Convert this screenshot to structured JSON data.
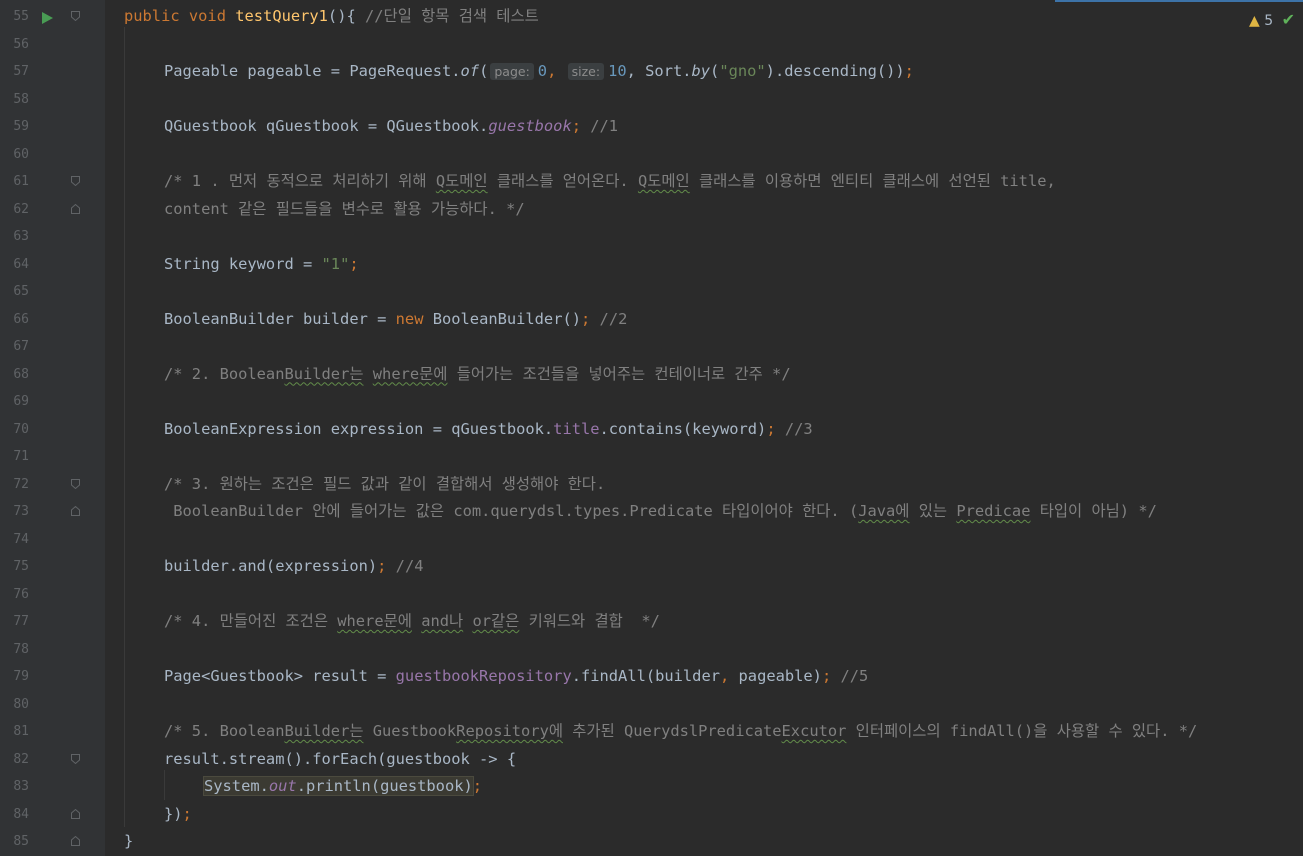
{
  "colors": {
    "background": "#2b2b2b",
    "gutter": "#313335",
    "keyword": "#cc7832",
    "method_decl": "#ffc66d",
    "comment": "#808080",
    "string": "#6a8759",
    "number": "#6897bb",
    "field": "#9876aa",
    "default_text": "#a9b7c6"
  },
  "inspections": {
    "warning_count": "5",
    "warning_icon": "warning-triangle-icon",
    "status_icon": "check-icon"
  },
  "lines": {
    "l55": {
      "num": "55",
      "a": "public",
      "b": " ",
      "c": "void",
      "d": " ",
      "e": "testQuery1",
      "f": "(){ ",
      "g": "//단일 항목 검색 테스트"
    },
    "l56": {
      "num": "56"
    },
    "l57": {
      "num": "57",
      "a": "Pageable pageable = PageRequest.",
      "b": "of",
      "c": "(",
      "hint1": "page:",
      "d": "0",
      "e": ",",
      "hint2": "size:",
      "f": "10",
      "g": ", Sort.",
      "h": "by",
      "i": "(",
      "j": "\"gno\"",
      "k": ").descending())",
      "l": ";"
    },
    "l58": {
      "num": "58"
    },
    "l59": {
      "num": "59",
      "a": "QGuestbook qGuestbook = QGuestbook.",
      "b": "guestbook",
      "c": ";",
      "d": " //1"
    },
    "l60": {
      "num": "60"
    },
    "l61": {
      "num": "61",
      "a": "/* 1 . 먼저 동적으로 처리하기 위해 ",
      "b": "Q도메인",
      "c": " 클래스를 얻어온다. ",
      "d": "Q도메인",
      "e": " 클래스를 이용하면 엔티티 클래스에 선언된 title,"
    },
    "l62": {
      "num": "62",
      "a": "content 같은 필드들을 변수로 활용 가능하다. */"
    },
    "l63": {
      "num": "63"
    },
    "l64": {
      "num": "64",
      "a": "String keyword = ",
      "b": "\"1\"",
      "c": ";"
    },
    "l65": {
      "num": "65"
    },
    "l66": {
      "num": "66",
      "a": "BooleanBuilder builder = ",
      "b": "new",
      "c": " BooleanBuilder()",
      "d": ";",
      "e": " //2"
    },
    "l67": {
      "num": "67"
    },
    "l68": {
      "num": "68",
      "a": "/* 2. Boolean",
      "b": "Builder는",
      "c": " ",
      "d": "where문에",
      "e": " 들어가는 조건들을 넣어주는 컨테이너로 간주 */"
    },
    "l69": {
      "num": "69"
    },
    "l70": {
      "num": "70",
      "a": "BooleanExpression expression = qGuestbook.",
      "b": "title",
      "c": ".contains(keyword)",
      "d": ";",
      "e": " //3"
    },
    "l71": {
      "num": "71"
    },
    "l72": {
      "num": "72",
      "a": "/* 3. 원하는 조건은 필드 값과 같이 결합해서 생성해야 한다."
    },
    "l73": {
      "num": "73",
      "a": " BooleanBuilder 안에 들어가는 값은 com.querydsl.types.Predicate 타입이어야 한다. (",
      "b": "Java에",
      "c": " 있는 ",
      "d": "Predicae",
      "e": " 타입이 아님) */"
    },
    "l74": {
      "num": "74"
    },
    "l75": {
      "num": "75",
      "a": "builder.and(expression)",
      "b": ";",
      "c": " //4"
    },
    "l76": {
      "num": "76"
    },
    "l77": {
      "num": "77",
      "a": "/* 4. 만들어진 조건은 ",
      "b": "where문에",
      "c": " ",
      "d": "and나",
      "e": " ",
      "f": "or같은",
      "g": " 키워드와 결합  */"
    },
    "l78": {
      "num": "78"
    },
    "l79": {
      "num": "79",
      "a": "Page<Guestbook> result = ",
      "b": "guestbookRepository",
      "c": ".findAll(builder",
      "d": ",",
      "e": " pageable)",
      "f": ";",
      "g": " //5"
    },
    "l80": {
      "num": "80"
    },
    "l81": {
      "num": "81",
      "a": "/* 5. Boolean",
      "b": "Builder는",
      "c": " Guestbook",
      "d": "Repository에",
      "e": " 추가된 QuerydslPredicate",
      "f": "Excutor",
      "g": " 인터페이스의 findAll()을 사용할 수 있다. */"
    },
    "l82": {
      "num": "82",
      "a": "result.stream().forEach(guestbook -> {"
    },
    "l83": {
      "num": "83",
      "a": "System.",
      "b": "out",
      "c": ".println(guestbook)",
      "d": ";"
    },
    "l84": {
      "num": "84",
      "a": "})",
      "b": ";"
    },
    "l85": {
      "num": "85",
      "a": "}"
    }
  }
}
